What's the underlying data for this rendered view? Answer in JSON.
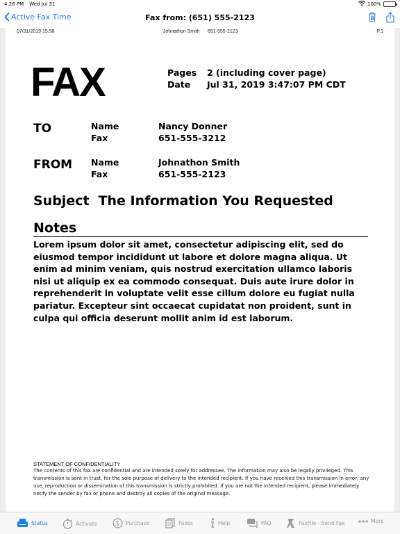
{
  "status_bar": {
    "time": "4:26 PM",
    "date": "Wed Jul 31",
    "battery": "100%"
  },
  "nav": {
    "back_label": "Active Fax Time",
    "title": "Fax from: (651) 555-2123",
    "icons": [
      "trash-icon",
      "share-icon"
    ]
  },
  "fax_header": {
    "datetime": "07/31/2019  15:58",
    "sender": "Johnathon Smith",
    "phone": "651-555-2123",
    "page": "P.1"
  },
  "cover": {
    "title": "FAX",
    "pages_label": "Pages",
    "pages_value": "2 (including cover page)",
    "date_label": "Date",
    "date_value": "Jul 31, 2019 3:47:07 PM CDT",
    "to": {
      "label": "TO",
      "name_label": "Name",
      "name": "Nancy Donner",
      "fax_label": "Fax",
      "fax": "651-555-3212"
    },
    "from": {
      "label": "FROM",
      "name_label": "Name",
      "name": "Johnathon Smith",
      "fax_label": "Fax",
      "fax": "651-555-2123"
    },
    "subject_label": "Subject",
    "subject": "The Information You Requested",
    "notes_title": "Notes",
    "notes": "Lorem ipsum dolor sit amet, consectetur adipiscing elit, sed do eiusmod tempor incididunt ut labore et dolore magna aliqua. Ut enim ad minim veniam, quis nostrud exercitation ullamco laboris nisi ut aliquip ex ea commodo consequat. Duis aute irure dolor in reprehenderit in voluptate velit esse cillum dolore eu fugiat nulla pariatur. Excepteur sint occaecat cupidatat non proident, sunt in culpa qui officia deserunt mollit anim id est laborum.",
    "confidentiality_title": "Statement of Confidentiality",
    "confidentiality_text": "The contents of this fax are confidential and are intended solely for addressee. The information may also be legally privileged. This transmission is sent in trust, for the sole purpose of delivery to the intended recipient. If you have received this transmission in error, any use, reproduction or dissemination of this transmission is strictly prohibited. If you are not the intended recipient, please immediately notify the sender by fax or phone and destroy all copies of the original message."
  },
  "tabs": [
    {
      "label": "Status",
      "icon": "fax-machine-icon",
      "active": true
    },
    {
      "label": "Activate",
      "icon": "stopwatch-icon",
      "active": false
    },
    {
      "label": "Purchase",
      "icon": "dollar-icon",
      "active": false
    },
    {
      "label": "Faxes",
      "icon": "documents-icon",
      "active": false
    },
    {
      "label": "Help",
      "icon": "info-icon",
      "active": false
    },
    {
      "label": "FAQ",
      "icon": "chat-icon",
      "active": false
    },
    {
      "label": "FaxFile - Send Fax",
      "icon": "fax-file-icon",
      "active": false
    },
    {
      "label": "More",
      "icon": "more-dots-icon",
      "active": false
    }
  ],
  "colors": {
    "accent": "#1a7cf6",
    "inactive": "#9a9a9a"
  }
}
